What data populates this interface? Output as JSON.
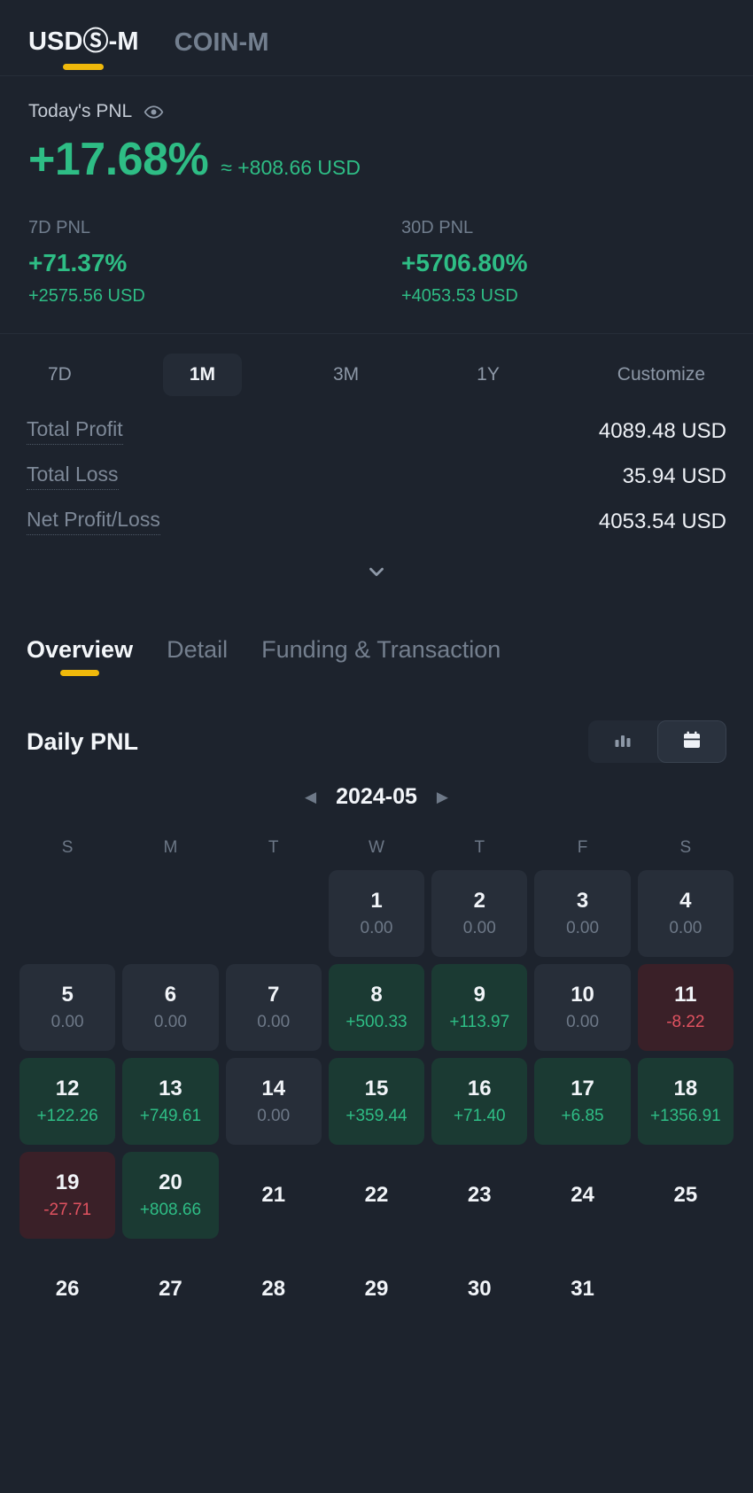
{
  "market_tabs": [
    {
      "label": "USDⓈ-M",
      "active": true
    },
    {
      "label": "COIN-M",
      "active": false
    }
  ],
  "summary": {
    "today_label": "Today's PNL",
    "eye_icon": "eye-icon",
    "today_pct": "+17.68%",
    "today_usd": "≈ +808.66 USD",
    "cards": [
      {
        "title": "7D PNL",
        "pct": "+71.37%",
        "usd": "+2575.56 USD"
      },
      {
        "title": "30D PNL",
        "pct": "+5706.80%",
        "usd": "+4053.53 USD"
      }
    ]
  },
  "range": {
    "options": [
      {
        "label": "7D",
        "active": false
      },
      {
        "label": "1M",
        "active": true
      },
      {
        "label": "3M",
        "active": false
      },
      {
        "label": "1Y",
        "active": false
      },
      {
        "label": "Customize",
        "active": false
      }
    ]
  },
  "totals": {
    "rows": [
      {
        "label": "Total Profit",
        "value": "4089.48 USD"
      },
      {
        "label": "Total Loss",
        "value": "35.94 USD"
      },
      {
        "label": "Net Profit/Loss",
        "value": "4053.54 USD"
      }
    ],
    "expand_icon": "chevron-down-icon"
  },
  "section_tabs": [
    {
      "label": "Overview",
      "active": true
    },
    {
      "label": "Detail",
      "active": false
    },
    {
      "label": "Funding & Transaction",
      "active": false
    }
  ],
  "daily": {
    "title": "Daily PNL",
    "view_toggle": [
      {
        "icon": "bar-chart-icon",
        "active": false
      },
      {
        "icon": "calendar-icon",
        "active": true
      }
    ],
    "month": "2024-05",
    "prev_icon": "caret-left-icon",
    "next_icon": "caret-right-icon",
    "weekdays": [
      "S",
      "M",
      "T",
      "W",
      "T",
      "F",
      "S"
    ]
  },
  "colors": {
    "accent": "#f0b90b",
    "positive": "#2ebd85",
    "negative": "#e05260",
    "background": "#1d232d",
    "cell_zero": "#272e39",
    "cell_positive": "#1b3a33",
    "cell_negative": "#3a2028"
  },
  "chart_data": {
    "type": "heatmap",
    "title": "Daily PNL",
    "month": "2024-05",
    "unit": "USD",
    "weekdays": [
      "S",
      "M",
      "T",
      "W",
      "T",
      "F",
      "S"
    ],
    "start_weekday_index": 3,
    "days_in_month": 31,
    "values": [
      {
        "day": 1,
        "value": "0.00",
        "state": "zero"
      },
      {
        "day": 2,
        "value": "0.00",
        "state": "zero"
      },
      {
        "day": 3,
        "value": "0.00",
        "state": "zero"
      },
      {
        "day": 4,
        "value": "0.00",
        "state": "zero"
      },
      {
        "day": 5,
        "value": "0.00",
        "state": "zero"
      },
      {
        "day": 6,
        "value": "0.00",
        "state": "zero"
      },
      {
        "day": 7,
        "value": "0.00",
        "state": "zero"
      },
      {
        "day": 8,
        "value": "+500.33",
        "state": "pos"
      },
      {
        "day": 9,
        "value": "+113.97",
        "state": "pos"
      },
      {
        "day": 10,
        "value": "0.00",
        "state": "zero"
      },
      {
        "day": 11,
        "value": "-8.22",
        "state": "neg"
      },
      {
        "day": 12,
        "value": "+122.26",
        "state": "pos"
      },
      {
        "day": 13,
        "value": "+749.61",
        "state": "pos"
      },
      {
        "day": 14,
        "value": "0.00",
        "state": "zero"
      },
      {
        "day": 15,
        "value": "+359.44",
        "state": "pos"
      },
      {
        "day": 16,
        "value": "+71.40",
        "state": "pos"
      },
      {
        "day": 17,
        "value": "+6.85",
        "state": "pos"
      },
      {
        "day": 18,
        "value": "+1356.91",
        "state": "pos"
      },
      {
        "day": 19,
        "value": "-27.71",
        "state": "neg"
      },
      {
        "day": 20,
        "value": "+808.66",
        "state": "pos"
      },
      {
        "day": 21,
        "value": "",
        "state": "future"
      },
      {
        "day": 22,
        "value": "",
        "state": "future"
      },
      {
        "day": 23,
        "value": "",
        "state": "future"
      },
      {
        "day": 24,
        "value": "",
        "state": "future"
      },
      {
        "day": 25,
        "value": "",
        "state": "future"
      },
      {
        "day": 26,
        "value": "",
        "state": "future"
      },
      {
        "day": 27,
        "value": "",
        "state": "future"
      },
      {
        "day": 28,
        "value": "",
        "state": "future"
      },
      {
        "day": 29,
        "value": "",
        "state": "future"
      },
      {
        "day": 30,
        "value": "",
        "state": "future"
      },
      {
        "day": 31,
        "value": "",
        "state": "future"
      }
    ]
  }
}
